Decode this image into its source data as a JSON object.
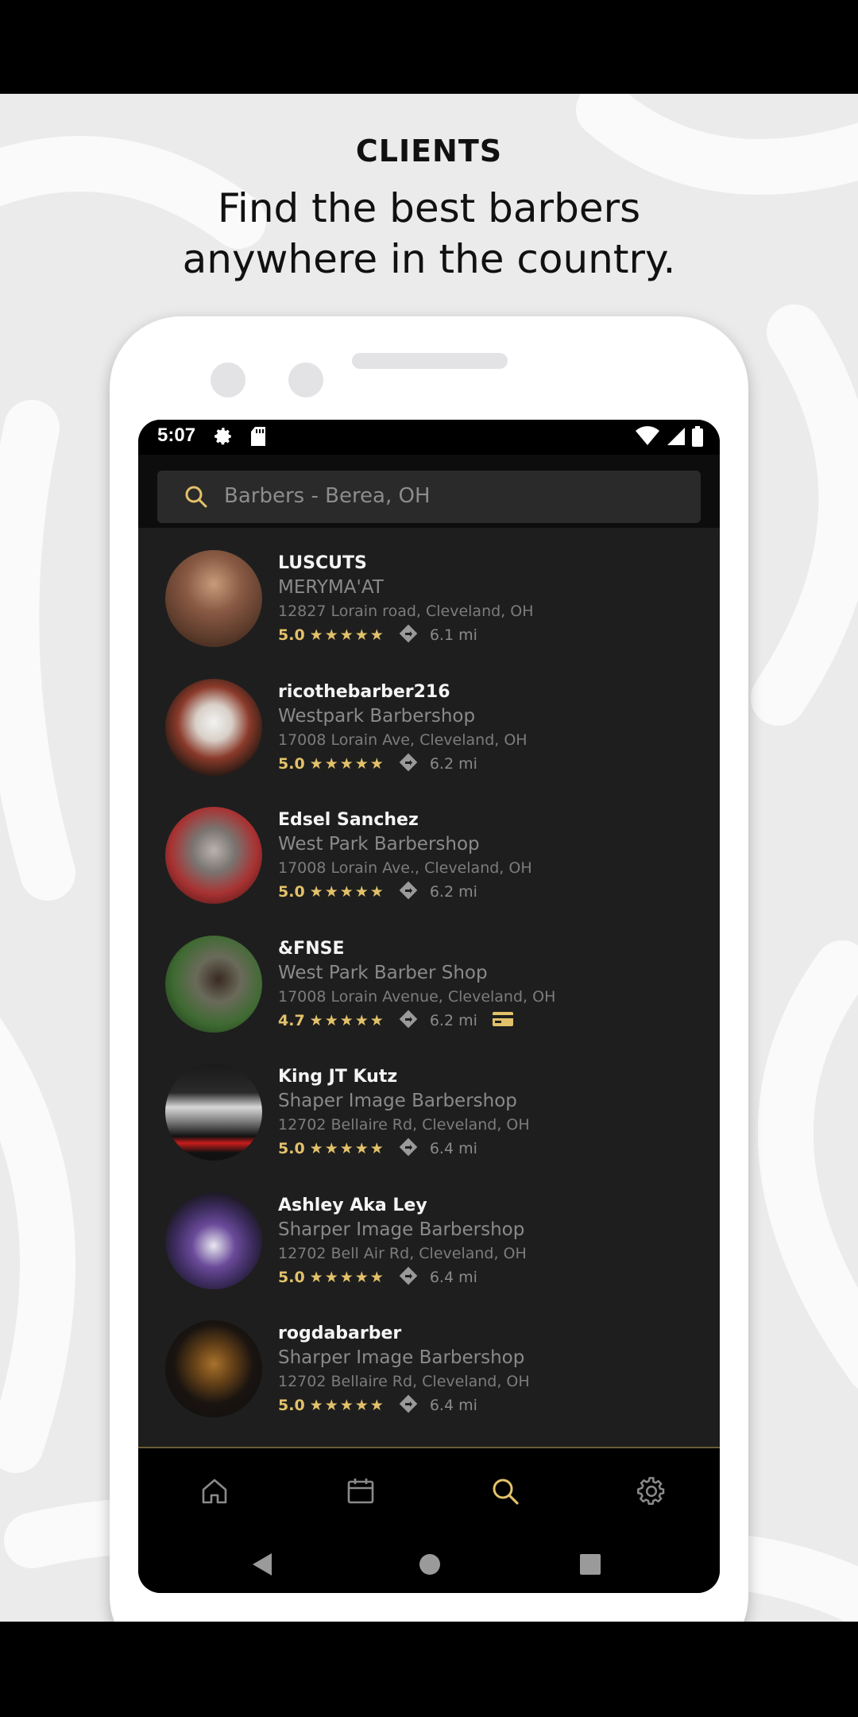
{
  "promo": {
    "label": "CLIENTS",
    "headline_line1": "Find the best barbers",
    "headline_line2": "anywhere in the country."
  },
  "status_bar": {
    "time": "5:07",
    "icons": [
      "gear-icon",
      "sd-card-icon",
      "wifi-icon",
      "signal-icon",
      "battery-icon"
    ]
  },
  "search": {
    "text": "Barbers - Berea, OH"
  },
  "colors": {
    "accent_gold": "#e2c16a",
    "screen_bg": "#1e1e1e",
    "search_bg": "#2a2a2a"
  },
  "barbers": [
    {
      "name": "LUSCUTS",
      "shop": "MERYMA'AT",
      "address": "12827 Lorain road, Cleveland, OH",
      "rating": "5.0",
      "stars": "★★★★★",
      "distance": "6.1 mi",
      "card": false
    },
    {
      "name": "ricothebarber216",
      "shop": "Westpark Barbershop",
      "address": "17008 Lorain Ave, Cleveland, OH",
      "rating": "5.0",
      "stars": "★★★★★",
      "distance": "6.2 mi",
      "card": false
    },
    {
      "name": "Edsel Sanchez",
      "shop": "West Park Barbershop",
      "address": "17008 Lorain Ave., Cleveland, OH",
      "rating": "5.0",
      "stars": "★★★★★",
      "distance": "6.2 mi",
      "card": false
    },
    {
      "name": "&FNSE",
      "shop": "West Park Barber Shop",
      "address": "17008 Lorain Avenue, Cleveland, OH",
      "rating": "4.7",
      "stars": "★★★★★",
      "distance": "6.2 mi",
      "card": true
    },
    {
      "name": "King JT Kutz",
      "shop": "Shaper Image Barbershop",
      "address": "12702 Bellaire Rd, Cleveland, OH",
      "rating": "5.0",
      "stars": "★★★★★",
      "distance": "6.4 mi",
      "card": false
    },
    {
      "name": "Ashley Aka Ley",
      "shop": "Sharper Image Barbershop",
      "address": "12702 Bell Air Rd, Cleveland, OH",
      "rating": "5.0",
      "stars": "★★★★★",
      "distance": "6.4 mi",
      "card": false
    },
    {
      "name": "rogdabarber",
      "shop": "Sharper Image Barbershop",
      "address": "12702 Bellaire Rd, Cleveland, OH",
      "rating": "5.0",
      "stars": "★★★★★",
      "distance": "6.4 mi",
      "card": false
    }
  ],
  "tabs": [
    {
      "icon": "home-icon",
      "active": false
    },
    {
      "icon": "calendar-icon",
      "active": false
    },
    {
      "icon": "search-icon",
      "active": true
    },
    {
      "icon": "gear-icon",
      "active": false
    }
  ],
  "system_nav": [
    "back-icon",
    "home-circle-icon",
    "recents-icon"
  ]
}
